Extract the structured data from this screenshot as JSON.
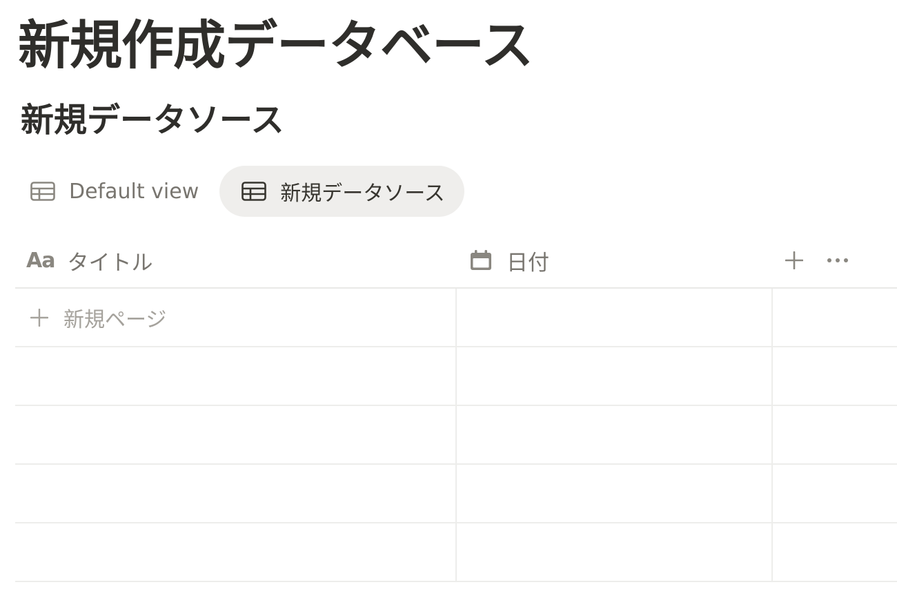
{
  "page": {
    "title": "新規作成データベース",
    "source_title": "新規データソース"
  },
  "tabs": [
    {
      "label": "Default view",
      "icon": "table-icon",
      "active": false
    },
    {
      "label": "新規データソース",
      "icon": "table-icon",
      "active": true
    }
  ],
  "table": {
    "columns": [
      {
        "label": "タイトル",
        "icon": "text-property-icon",
        "icon_glyph": "Aa"
      },
      {
        "label": "日付",
        "icon": "calendar-icon"
      }
    ],
    "new_page_label": "新規ページ",
    "empty_rows": 4
  },
  "colors": {
    "text": "#37352f",
    "muted": "#78756f",
    "placeholder": "#a5a29c",
    "active_tab_bg": "#efeeec",
    "border": "#e9e9e7"
  }
}
